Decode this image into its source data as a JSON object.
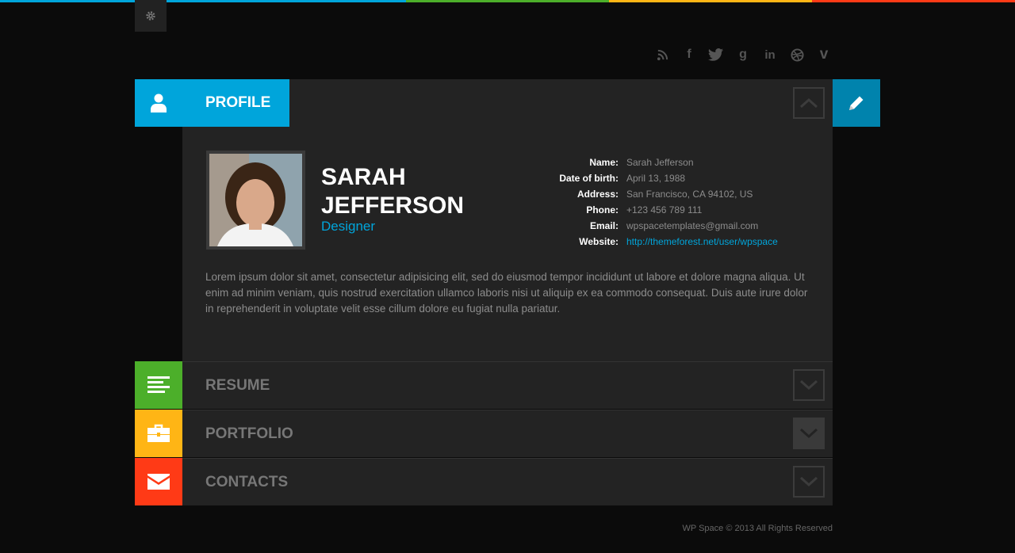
{
  "topbar": {
    "colors": [
      "#00a5db",
      "#00a5db",
      "#4caf2a",
      "#ffb515",
      "#ff3a16"
    ]
  },
  "header": {
    "settings_icon": "gear-icon",
    "social": [
      "rss-icon",
      "facebook-icon",
      "twitter-icon",
      "google-plus-icon",
      "linkedin-icon",
      "dribbble-icon",
      "vimeo-icon"
    ],
    "social_glyphs": [
      "",
      "f",
      "",
      "g",
      "in",
      "",
      "v"
    ]
  },
  "profile": {
    "tab_label": "PROFILE",
    "tab_color": "#00a5db",
    "edit_color": "#0083ad",
    "first_name": "SARAH",
    "last_name": "JEFFERSON",
    "role": "Designer",
    "info": [
      {
        "label": "Name:",
        "value": "Sarah Jefferson"
      },
      {
        "label": "Date of birth:",
        "value": "April 13, 1988"
      },
      {
        "label": "Address:",
        "value": "San Francisco, CA 94102, US"
      },
      {
        "label": "Phone:",
        "value": "+123 456 789 111"
      },
      {
        "label": "Email:",
        "value": "wpspacetemplates@gmail.com"
      },
      {
        "label": "Website:",
        "value": "http://themeforest.net/user/wpspace"
      }
    ],
    "bio": "Lorem ipsum dolor sit amet, consectetur adipisicing elit, sed do eiusmod tempor incididunt ut labore et dolore magna aliqua. Ut enim ad minim veniam, quis nostrud exercitation ullamco laboris nisi ut aliquip ex ea commodo consequat. Duis aute irure dolor in reprehenderit in voluptate velit esse cillum dolore eu fugiat nulla pariatur."
  },
  "sections": [
    {
      "label": "RESUME",
      "color": "#4caf2a",
      "icon": "list-icon"
    },
    {
      "label": "PORTFOLIO",
      "color": "#ffb515",
      "icon": "briefcase-icon"
    },
    {
      "label": "CONTACTS",
      "color": "#ff3a16",
      "icon": "envelope-icon"
    }
  ],
  "footer": {
    "text": "WP Space © 2013 All Rights Reserved"
  }
}
